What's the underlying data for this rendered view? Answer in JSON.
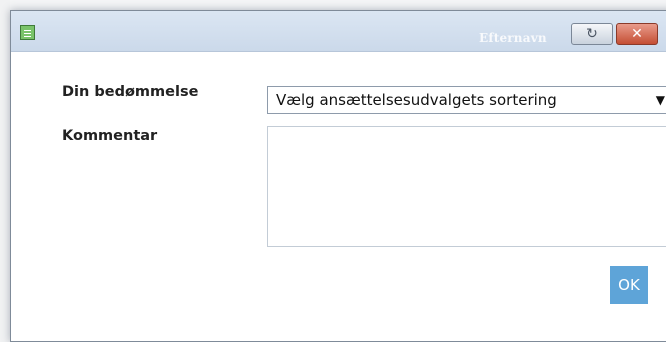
{
  "window": {
    "title": "Efternavn",
    "restore_icon": "↻",
    "close_icon": "✕"
  },
  "form": {
    "rating_label": "Din bedømmelse",
    "rating_select_value": "Vælg ansættelsesudvalgets sortering",
    "dropdown_arrow": "▼",
    "comment_label": "Kommentar",
    "comment_value": ""
  },
  "actions": {
    "ok_label": "OK"
  },
  "colors": {
    "titlebar": "#cbd9ea",
    "close_button": "#c44e34",
    "ok_button": "#5ea4d8"
  }
}
